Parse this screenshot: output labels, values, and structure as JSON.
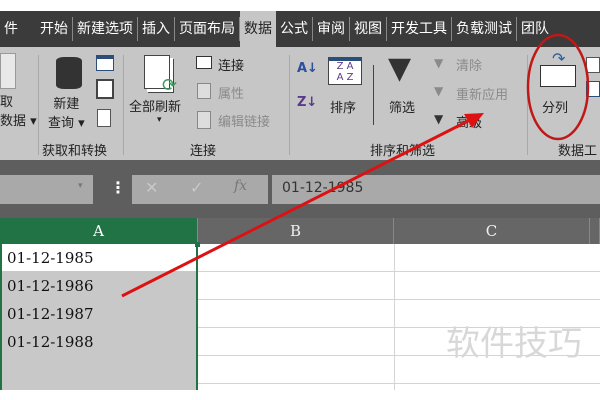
{
  "tabs": [
    "件",
    "开始",
    "新建选项",
    "插入",
    "页面布局",
    "数据",
    "公式",
    "审阅",
    "视图",
    "开发工具",
    "负载测试",
    "团队"
  ],
  "active_tab": "数据",
  "ribbon": {
    "get_data": [
      "取",
      "数据"
    ],
    "new_query": [
      "新建",
      "查询"
    ],
    "refresh_all": "全部刷新",
    "connections": "连接",
    "properties": "属性",
    "edit_links": "编辑链接",
    "sort": "排序",
    "filter": "筛选",
    "clear": "清除",
    "reapply": "重新应用",
    "advanced": "高级",
    "text_to_columns": "分列",
    "groups": {
      "get_transform": "获取和转换",
      "connections": "连接",
      "sort_filter": "排序和筛选",
      "data_tools": "数据工"
    }
  },
  "formula_bar": {
    "value": "01-12-1985",
    "fx": "fx",
    "cancel": "✕",
    "enter": "✓"
  },
  "columns": [
    "A",
    "B",
    "C"
  ],
  "cells": [
    "01-12-1985",
    "01-12-1986",
    "01-12-1987",
    "01-12-1988"
  ],
  "watermark": "软件技巧"
}
